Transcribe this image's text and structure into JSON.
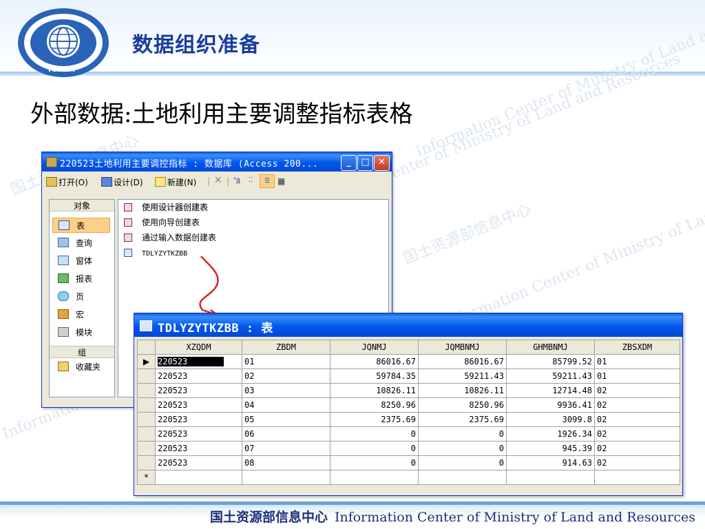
{
  "slide": {
    "title": "数据组织准备",
    "subtitle": "外部数据:土地利用主要调整指标表格",
    "logo_text": "ICMLR",
    "watermark_cn": "国土资源部信息中心",
    "watermark_en": "Information Center of Ministry of Land and Resources",
    "footer_cn": "国土资源部信息中心",
    "footer_en": "Information Center of Ministry of Land and Resources",
    "colors": {
      "title": "#1a3d9c",
      "xp_blue": "#0058ee",
      "selected_object": "#fdd08a"
    }
  },
  "db_window": {
    "title": "220523土地利用主要调控指标 : 数据库 (Access 200...",
    "toolbar": {
      "open_label": "打开(O)",
      "design_label": "设计(D)",
      "new_label": "新建(N)",
      "delete_icon": "delete-icon",
      "view_icons": [
        "large-icons-view-icon",
        "small-icons-view-icon",
        "list-view-icon",
        "details-view-icon"
      ]
    },
    "objects_header": "对象",
    "objects": [
      "表",
      "查询",
      "窗体",
      "报表",
      "页",
      "宏",
      "模块"
    ],
    "groups_header": "组",
    "groups": [
      "收藏夹"
    ],
    "list_items": [
      "使用设计器创建表",
      "使用向导创建表",
      "通过输入数据创建表",
      "TDLYZYTKZBB"
    ]
  },
  "datasheet": {
    "title": "TDLYZYTKZBB : 表",
    "columns": [
      "XZQDM",
      "ZBDM",
      "JQNMJ",
      "JQMBNMJ",
      "GHMBNMJ",
      "ZBSXDM"
    ],
    "rows": [
      [
        "220523",
        "01",
        "86016.67",
        "86016.67",
        "85799.52",
        "01"
      ],
      [
        "220523",
        "02",
        "59784.35",
        "59211.43",
        "59211.43",
        "01"
      ],
      [
        "220523",
        "03",
        "10826.11",
        "10826.11",
        "12714.48",
        "02"
      ],
      [
        "220523",
        "04",
        "8250.96",
        "8250.96",
        "9936.41",
        "02"
      ],
      [
        "220523",
        "05",
        "2375.69",
        "2375.69",
        "3099.8",
        "02"
      ],
      [
        "220523",
        "06",
        "0",
        "0",
        "1926.34",
        "02"
      ],
      [
        "220523",
        "07",
        "0",
        "0",
        "945.39",
        "02"
      ],
      [
        "220523",
        "08",
        "0",
        "0",
        "914.63",
        "02"
      ]
    ],
    "current_row_marker": "▶",
    "new_row_marker": "*"
  }
}
